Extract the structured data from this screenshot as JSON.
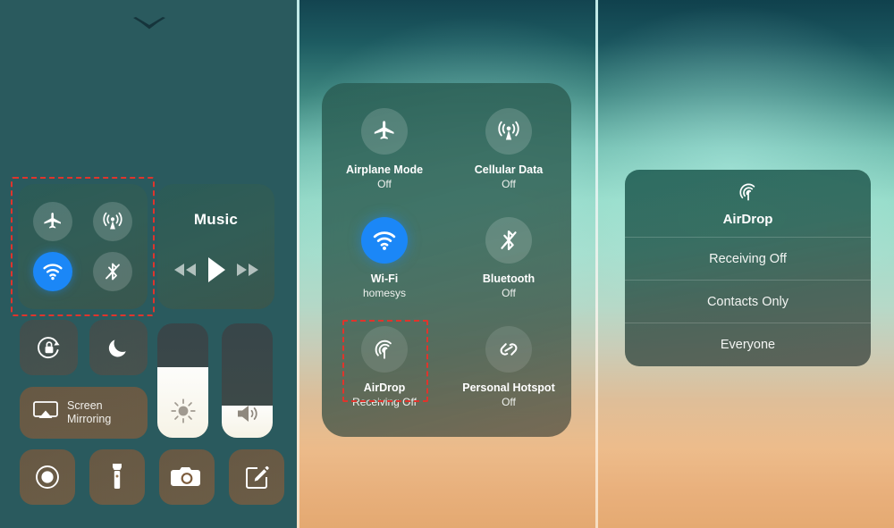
{
  "theme": {
    "accent_blue": "#1b87f7",
    "highlight_red": "#e0342c",
    "glass_green": "#2c5c56",
    "glass_brown": "#76583e"
  },
  "panels": {
    "left": {
      "name": "Control Center compact view",
      "chevron_icon": "chevron-down-icon",
      "connectivity": {
        "highlighted": true,
        "toggles": [
          {
            "icon": "airplane-icon",
            "label": "Airplane Mode",
            "state": "off"
          },
          {
            "icon": "cellular-icon",
            "label": "Cellular Data",
            "state": "off"
          },
          {
            "icon": "wifi-icon",
            "label": "Wi-Fi",
            "state": "on"
          },
          {
            "icon": "bluetooth-off-icon",
            "label": "Bluetooth",
            "state": "off"
          }
        ]
      },
      "music": {
        "title": "Music",
        "controls": [
          {
            "icon": "rewind-icon",
            "label": "Previous"
          },
          {
            "icon": "play-icon",
            "label": "Play"
          },
          {
            "icon": "forward-icon",
            "label": "Next"
          }
        ]
      },
      "rotation_lock": {
        "icon": "rotation-lock-icon",
        "label": "Portrait Orientation Lock"
      },
      "do_not_disturb": {
        "icon": "moon-icon",
        "label": "Do Not Disturb"
      },
      "screen_mirroring": {
        "icon": "screen-mirroring-icon",
        "line1": "Screen",
        "line2": "Mirroring"
      },
      "brightness": {
        "icon": "brightness-icon",
        "value": 62
      },
      "volume": {
        "icon": "volume-icon",
        "value": 28
      },
      "tiles": [
        {
          "icon": "screen-record-icon",
          "label": "Screen Recording"
        },
        {
          "icon": "flashlight-icon",
          "label": "Flashlight"
        },
        {
          "icon": "camera-icon",
          "label": "Camera"
        },
        {
          "icon": "notes-icon",
          "label": "Notes"
        }
      ]
    },
    "middle": {
      "name": "Connectivity module expanded",
      "items": [
        {
          "icon": "airplane-icon",
          "name": "Airplane Mode",
          "state": "Off",
          "active": false,
          "highlighted": false
        },
        {
          "icon": "cellular-icon",
          "name": "Cellular Data",
          "state": "Off",
          "active": false,
          "highlighted": false
        },
        {
          "icon": "wifi-icon",
          "name": "Wi-Fi",
          "state": "homesys",
          "active": true,
          "highlighted": false
        },
        {
          "icon": "bluetooth-off-icon",
          "name": "Bluetooth",
          "state": "Off",
          "active": false,
          "highlighted": false
        },
        {
          "icon": "airdrop-icon",
          "name": "AirDrop",
          "state": "Receiving Off",
          "active": false,
          "highlighted": true
        },
        {
          "icon": "personal-hotspot-icon",
          "name": "Personal Hotspot",
          "state": "Off",
          "active": false,
          "highlighted": false
        }
      ]
    },
    "right": {
      "name": "AirDrop options popup",
      "header": {
        "icon": "airdrop-icon",
        "label": "AirDrop"
      },
      "options": [
        {
          "label": "Receiving Off"
        },
        {
          "label": "Contacts Only"
        },
        {
          "label": "Everyone"
        }
      ]
    }
  }
}
